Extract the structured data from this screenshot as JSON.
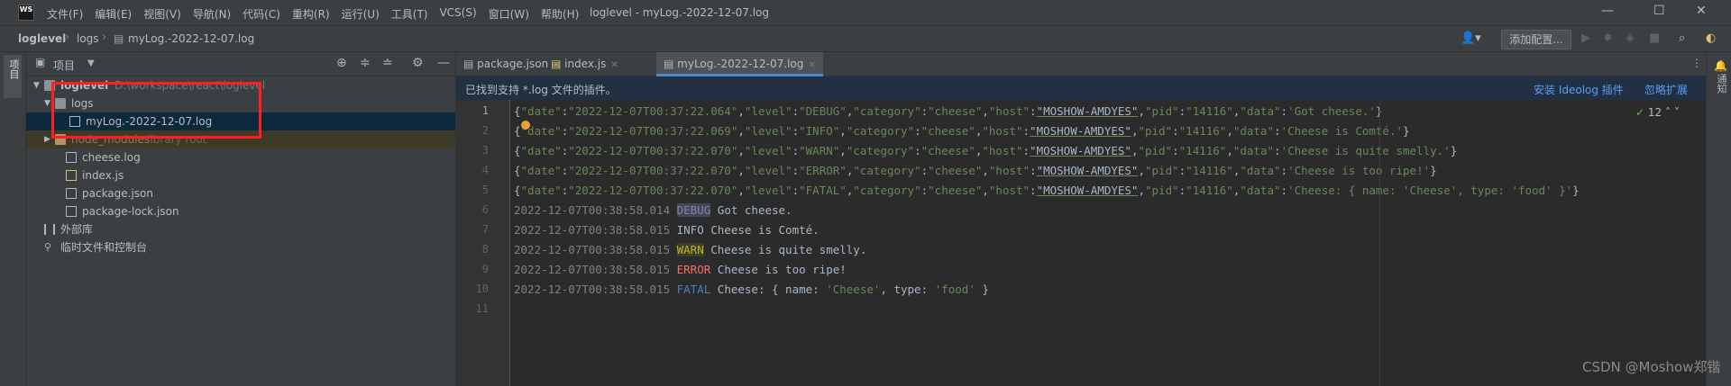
{
  "window": {
    "app_logo": "WS",
    "menu": [
      "文件(F)",
      "编辑(E)",
      "视图(V)",
      "导航(N)",
      "代码(C)",
      "重构(R)",
      "运行(U)",
      "工具(T)",
      "VCS(S)",
      "窗口(W)",
      "帮助(H)"
    ],
    "title": "loglevel - myLog.-2022-12-07.log",
    "controls": {
      "minimize": "—",
      "maximize": "☐",
      "close": "✕"
    }
  },
  "navbar": {
    "breadcrumbs": [
      "loglevel",
      "logs",
      "myLog.-2022-12-07.log"
    ],
    "run_config": "添加配置..."
  },
  "left_strip": {
    "project_tab": "项目"
  },
  "project_panel": {
    "title": "项目",
    "tree": [
      {
        "label": "loglevel",
        "suffix": "D:\\workspace\\react\\loglevel",
        "type": "folder",
        "level": 0,
        "expanded": true
      },
      {
        "label": "logs",
        "type": "folder",
        "level": 1,
        "expanded": true
      },
      {
        "label": "myLog.-2022-12-07.log",
        "type": "file",
        "level": 2,
        "selected": true
      },
      {
        "label": "node_modules",
        "suffix": "library root",
        "type": "folder",
        "level": 1,
        "expanded": false
      },
      {
        "label": "cheese.log",
        "type": "file",
        "level": 1
      },
      {
        "label": "index.js",
        "type": "file",
        "level": 1
      },
      {
        "label": "package.json",
        "type": "file",
        "level": 1
      },
      {
        "label": "package-lock.json",
        "type": "file",
        "level": 1
      },
      {
        "label": "外部库",
        "type": "lib",
        "level": 0
      },
      {
        "label": "临时文件和控制台",
        "type": "lib",
        "level": 0
      }
    ]
  },
  "tabs": [
    {
      "label": "package.json",
      "active": false
    },
    {
      "label": "index.js",
      "active": false
    },
    {
      "label": "myLog.-2022-12-07.log",
      "active": true
    }
  ],
  "banner": {
    "message": "已找到支持 *.log 文件的插件。",
    "install_link": "安装 Ideolog 插件",
    "ignore_link": "忽略扩展"
  },
  "editor": {
    "inspection_count": "12",
    "line_numbers": [
      "1",
      "2",
      "3",
      "4",
      "5",
      "6",
      "7",
      "8",
      "9",
      "10",
      "11"
    ],
    "json_lines": [
      {
        "date": "2022-12-07T00:37:22.064",
        "level": "DEBUG",
        "data": "Got cheese."
      },
      {
        "date": "2022-12-07T00:37:22.069",
        "level": "INFO",
        "data": "Cheese is Comté."
      },
      {
        "date": "2022-12-07T00:37:22.070",
        "level": "WARN",
        "data": "Cheese is quite smelly."
      },
      {
        "date": "2022-12-07T00:37:22.070",
        "level": "ERROR",
        "data": "Cheese is too ripe!"
      },
      {
        "date": "2022-12-07T00:37:22.070",
        "level": "FATAL",
        "data": "Cheese: { name: 'Cheese', type: 'food' }"
      }
    ],
    "json_common": {
      "category": "cheese",
      "host": "MOSHOW-AMDYES",
      "pid": "14116"
    },
    "plain_lines": [
      {
        "ts": "2022-12-07T00:38:58.014",
        "level": "DEBUG",
        "msg": "Got cheese."
      },
      {
        "ts": "2022-12-07T00:38:58.015",
        "level": "INFO",
        "msg": "Cheese is Comté."
      },
      {
        "ts": "2022-12-07T00:38:58.015",
        "level": "WARN",
        "msg": "Cheese is quite smelly."
      },
      {
        "ts": "2022-12-07T00:38:58.015",
        "level": "ERROR",
        "msg": "Cheese is too ripe!"
      },
      {
        "ts": "2022-12-07T00:38:58.015",
        "level": "FATAL",
        "msg": "Cheese: { name: 'Cheese', type: 'food' }"
      }
    ]
  },
  "right_strip": {
    "label": "通知"
  },
  "watermark": "CSDN @Moshow郑锴",
  "colors": {
    "accent": "#4a88c7",
    "highlight_box": "#ff1f1f",
    "link": "#589df6"
  }
}
